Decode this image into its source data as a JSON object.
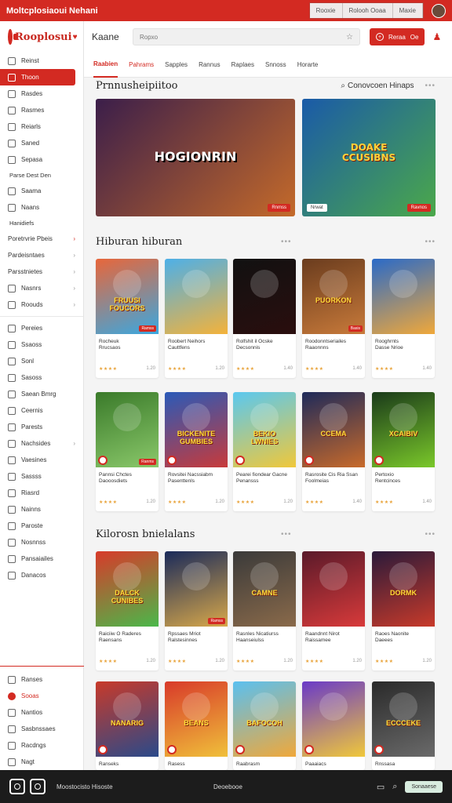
{
  "titlebar": {
    "title": "Moltcplosiaoui Nehani",
    "buttons": [
      "Rooxie",
      "Rolooh Ooaa",
      "Maxie"
    ]
  },
  "logo": {
    "text": "Rooplosui"
  },
  "topbar": {
    "brand": "Kaane",
    "search_placeholder": "Ropxo",
    "cta": "Reraa",
    "cta_count": "Oe"
  },
  "tabs": [
    "Raabien",
    "Pahrams",
    "Sapples",
    "Rannus",
    "Raplaes",
    "Snnoss",
    "Horarte"
  ],
  "sidebar": {
    "items_top": [
      "Reinst",
      "Thoon",
      "Rasdes",
      "Rasmes",
      "Reiarls",
      "Saned",
      "Sepasa"
    ],
    "group1_head": "Parse Dest Den",
    "items_mid": [
      "Saama",
      "Naans"
    ],
    "group2_head": "Hanidiefs",
    "expandables": [
      "Poretrvrie Pbeis",
      "Pardeisntaes",
      "Parsstnietes",
      "Nasnrs",
      "Roouds"
    ],
    "items_lower": [
      "Pereies",
      "Ssaoss",
      "Sonl",
      "Sasoss",
      "Saean Bmrg",
      "Ceernis",
      "Parests",
      "Nachsides",
      "Vaesines",
      "Sassss",
      "Riasrd",
      "Nainns",
      "Paroste",
      "Nosnnss",
      "Pansaiailes",
      "Danacos"
    ],
    "bottom_items": [
      "Ranses",
      "Sooas",
      "Nantios",
      "Sasbnssaes",
      "Racdngs",
      "Nagt"
    ]
  },
  "sections": [
    {
      "title": "Prnnusheipiitoo",
      "search_label": "Conovcoen Hinaps"
    },
    {
      "title": "Hiburan hiburan"
    },
    {
      "title": "Kilorosn bnielalans"
    }
  ],
  "banners": [
    {
      "logo": "HOGIONRIN",
      "tag": "Rnmss",
      "colors": [
        "#3b1e4a",
        "#c46a2a"
      ]
    },
    {
      "logo": "DOAKE\nCCUSIBNS",
      "chip": "Nrwat",
      "tag": "Ravnos",
      "colors": [
        "#1a5aa8",
        "#4ba84a"
      ]
    }
  ],
  "cards": [
    {
      "logo": "FRUUSI\nFOUCORS",
      "title": "Rocheuk\nRrucsaos",
      "dev": "",
      "badge": "Ramss",
      "colors": [
        "#e8663a",
        "#3aa8e0"
      ],
      "price": "1.20"
    },
    {
      "logo": "",
      "title": "Roobert Neihors\nCauttfens",
      "dev": "",
      "badge": "",
      "colors": [
        "#4db0e8",
        "#f4b23a"
      ],
      "price": "1.20"
    },
    {
      "logo": "",
      "title": "Rolfshit il Ocske\nDecsonnis",
      "dev": "",
      "badge": "",
      "colors": [
        "#111111",
        "#2a0e0e"
      ],
      "price": "1.40"
    },
    {
      "logo": "PUORKON",
      "title": "Roodonntseriailes\nRaaonnns",
      "dev": "",
      "badge": "Basis",
      "colors": [
        "#6a3c1e",
        "#c87a3a"
      ],
      "price": "1.40"
    },
    {
      "logo": "",
      "title": "Rooghrnts\nDasse Nrioe",
      "dev": "",
      "badge": "",
      "colors": [
        "#2a6ac8",
        "#f0a83a"
      ],
      "price": "1.40"
    },
    {
      "logo": "",
      "title": "Pannsi Chctes\nDaooosdiets",
      "dev": "",
      "badge": "Ranms",
      "colors": [
        "#3a7a2a",
        "#8ac86a"
      ],
      "price": "1.20"
    },
    {
      "logo": "BICKENITE\nGUMBIES",
      "title": "Rovsitei Nacssiabm\nPasenttenls",
      "dev": "",
      "badge": "",
      "colors": [
        "#2a5ab8",
        "#c83a3a"
      ],
      "price": "1.20"
    },
    {
      "logo": "BEKIO\nLWNIES",
      "title": "Pearei fiondear Gacne\nPenansss",
      "dev": "",
      "badge": "",
      "colors": [
        "#5ac8f0",
        "#f0c83a"
      ],
      "price": "1.20"
    },
    {
      "logo": "CCEMA",
      "title": "Rasrosite Cis Ria Ssan\nFoolmeias",
      "dev": "",
      "badge": "",
      "colors": [
        "#1e2a5a",
        "#c86a2a"
      ],
      "price": "1.40"
    },
    {
      "logo": "XCAIBIV",
      "title": "Pertoxio\nRentcinces",
      "dev": "",
      "badge": "",
      "colors": [
        "#1a3a1a",
        "#7ac82a"
      ],
      "price": "1.40"
    },
    {
      "logo": "DALCK\nCUNIBES",
      "title": "Raiciiw O Raderes\nRaensans",
      "dev": "",
      "badge": "",
      "colors": [
        "#d83a2a",
        "#4ab84a"
      ],
      "price": "1.20"
    },
    {
      "logo": "",
      "title": "Rpssaes Mriot\nRalstesinnes",
      "dev": "",
      "badge": "Ramss",
      "colors": [
        "#1a2a5a",
        "#d8a84a"
      ],
      "price": "1.20"
    },
    {
      "logo": "CAMNE",
      "title": "Rasnles Nicatiurss\nHaanseiulss",
      "dev": "",
      "badge": "",
      "colors": [
        "#3a3a3a",
        "#8a6a4a"
      ],
      "price": "1.20"
    },
    {
      "logo": "",
      "title": "Raandnnt Nirot\nRaissamee",
      "dev": "",
      "badge": "",
      "colors": [
        "#5a1a2a",
        "#d83a3a"
      ],
      "price": "1.20"
    },
    {
      "logo": "DORMK",
      "title": "Raoes Naonite\nDaeees",
      "dev": "",
      "badge": "",
      "colors": [
        "#2a1a3a",
        "#c83a2a"
      ],
      "price": "1.20"
    },
    {
      "logo": "NANARIG",
      "title": "Ranseks",
      "dev": "",
      "badge": "",
      "colors": [
        "#c83a2a",
        "#2a4a8a"
      ],
      "price": ""
    },
    {
      "logo": "BEANS",
      "title": "Rasess",
      "dev": "",
      "badge": "",
      "colors": [
        "#d83a2a",
        "#f0c03a"
      ],
      "price": ""
    },
    {
      "logo": "BAFOCOH",
      "title": "Raabrasm",
      "dev": "",
      "badge": "",
      "colors": [
        "#5ac0f0",
        "#f0a83a"
      ],
      "price": ""
    },
    {
      "logo": "",
      "title": "Paaaiacs",
      "dev": "",
      "badge": "",
      "colors": [
        "#6a3ac8",
        "#f0c83a"
      ],
      "price": ""
    },
    {
      "logo": "ECCCEKE",
      "title": "Rnssasa",
      "dev": "",
      "badge": "",
      "colors": [
        "#2a2a2a",
        "#6a6a6a"
      ],
      "price": ""
    }
  ],
  "bottombar": {
    "label": "Moostocisto Hisoste",
    "center": "Deoebooe",
    "button": "Sonaaese"
  }
}
